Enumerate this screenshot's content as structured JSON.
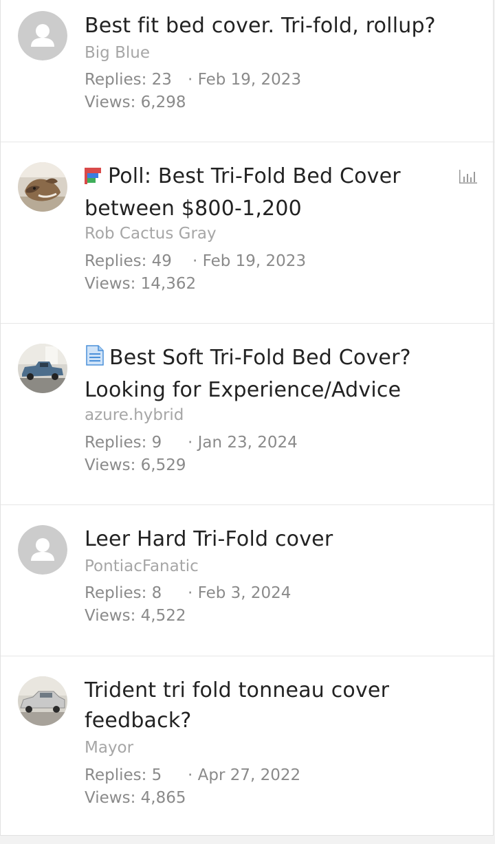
{
  "threads": [
    {
      "title": "Best fit bed cover. Tri-fold, rollup?",
      "prefix": "",
      "author": "Big Blue",
      "replies": "Replies: 23",
      "date": "· Feb 19, 2023",
      "views": "Views: 6,298",
      "avatar": "default-user-icon"
    },
    {
      "title": "Best Tri-Fold Bed Cover between $800-1,200",
      "prefix": "Poll:",
      "author": "Rob Cactus Gray",
      "replies": "Replies: 49",
      "date": "· Feb 19, 2023",
      "views": "Views: 14,362",
      "avatar": "dog-photo"
    },
    {
      "title": "Best Soft Tri-Fold Bed Cover? Looking for Experience/Advice",
      "prefix": "",
      "author": "azure.hybrid",
      "replies": "Replies: 9",
      "date": "· Jan 23, 2024",
      "views": "Views: 6,529",
      "avatar": "truck-photo"
    },
    {
      "title": "Leer Hard Tri-Fold cover",
      "prefix": "",
      "author": "PontiacFanatic",
      "replies": "Replies: 8",
      "date": "· Feb 3, 2024",
      "views": "Views: 4,522",
      "avatar": "default-user-icon"
    },
    {
      "title": "Trident tri fold tonneau cover feedback?",
      "prefix": "",
      "author": "Mayor",
      "replies": "Replies: 5",
      "date": "· Apr 27, 2022",
      "views": "Views: 4,865",
      "avatar": "car-photo"
    }
  ],
  "icons": {
    "poll_prefix": "poll-flag-icon",
    "article_prefix": "document-icon",
    "poll_indicator": "bar-chart-icon"
  },
  "colors": {
    "title": "#222222",
    "author": "#a6a6a6",
    "meta": "#8a8a8a",
    "avatar_default": "#cccccc"
  }
}
